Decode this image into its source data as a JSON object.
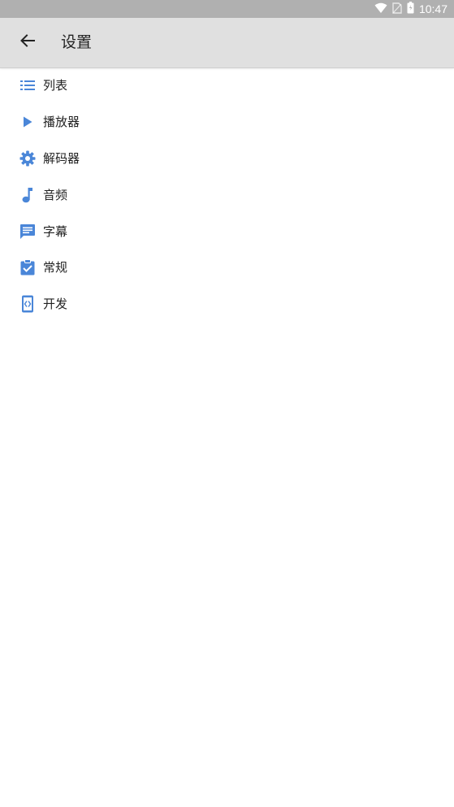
{
  "status_bar": {
    "time": "10:47",
    "icons": [
      "wifi-icon",
      "no-sim-icon",
      "battery-icon"
    ]
  },
  "app_bar": {
    "title": "设置",
    "back_icon": "arrow-back-icon"
  },
  "accent_color": "#4a86d8",
  "settings_list": [
    {
      "label": "列表",
      "icon": "list-icon"
    },
    {
      "label": "播放器",
      "icon": "play-icon"
    },
    {
      "label": "解码器",
      "icon": "gear-icon"
    },
    {
      "label": "音频",
      "icon": "music-note-icon"
    },
    {
      "label": "字幕",
      "icon": "subtitle-icon"
    },
    {
      "label": "常规",
      "icon": "clipboard-check-icon"
    },
    {
      "label": "开发",
      "icon": "developer-mode-icon"
    }
  ]
}
